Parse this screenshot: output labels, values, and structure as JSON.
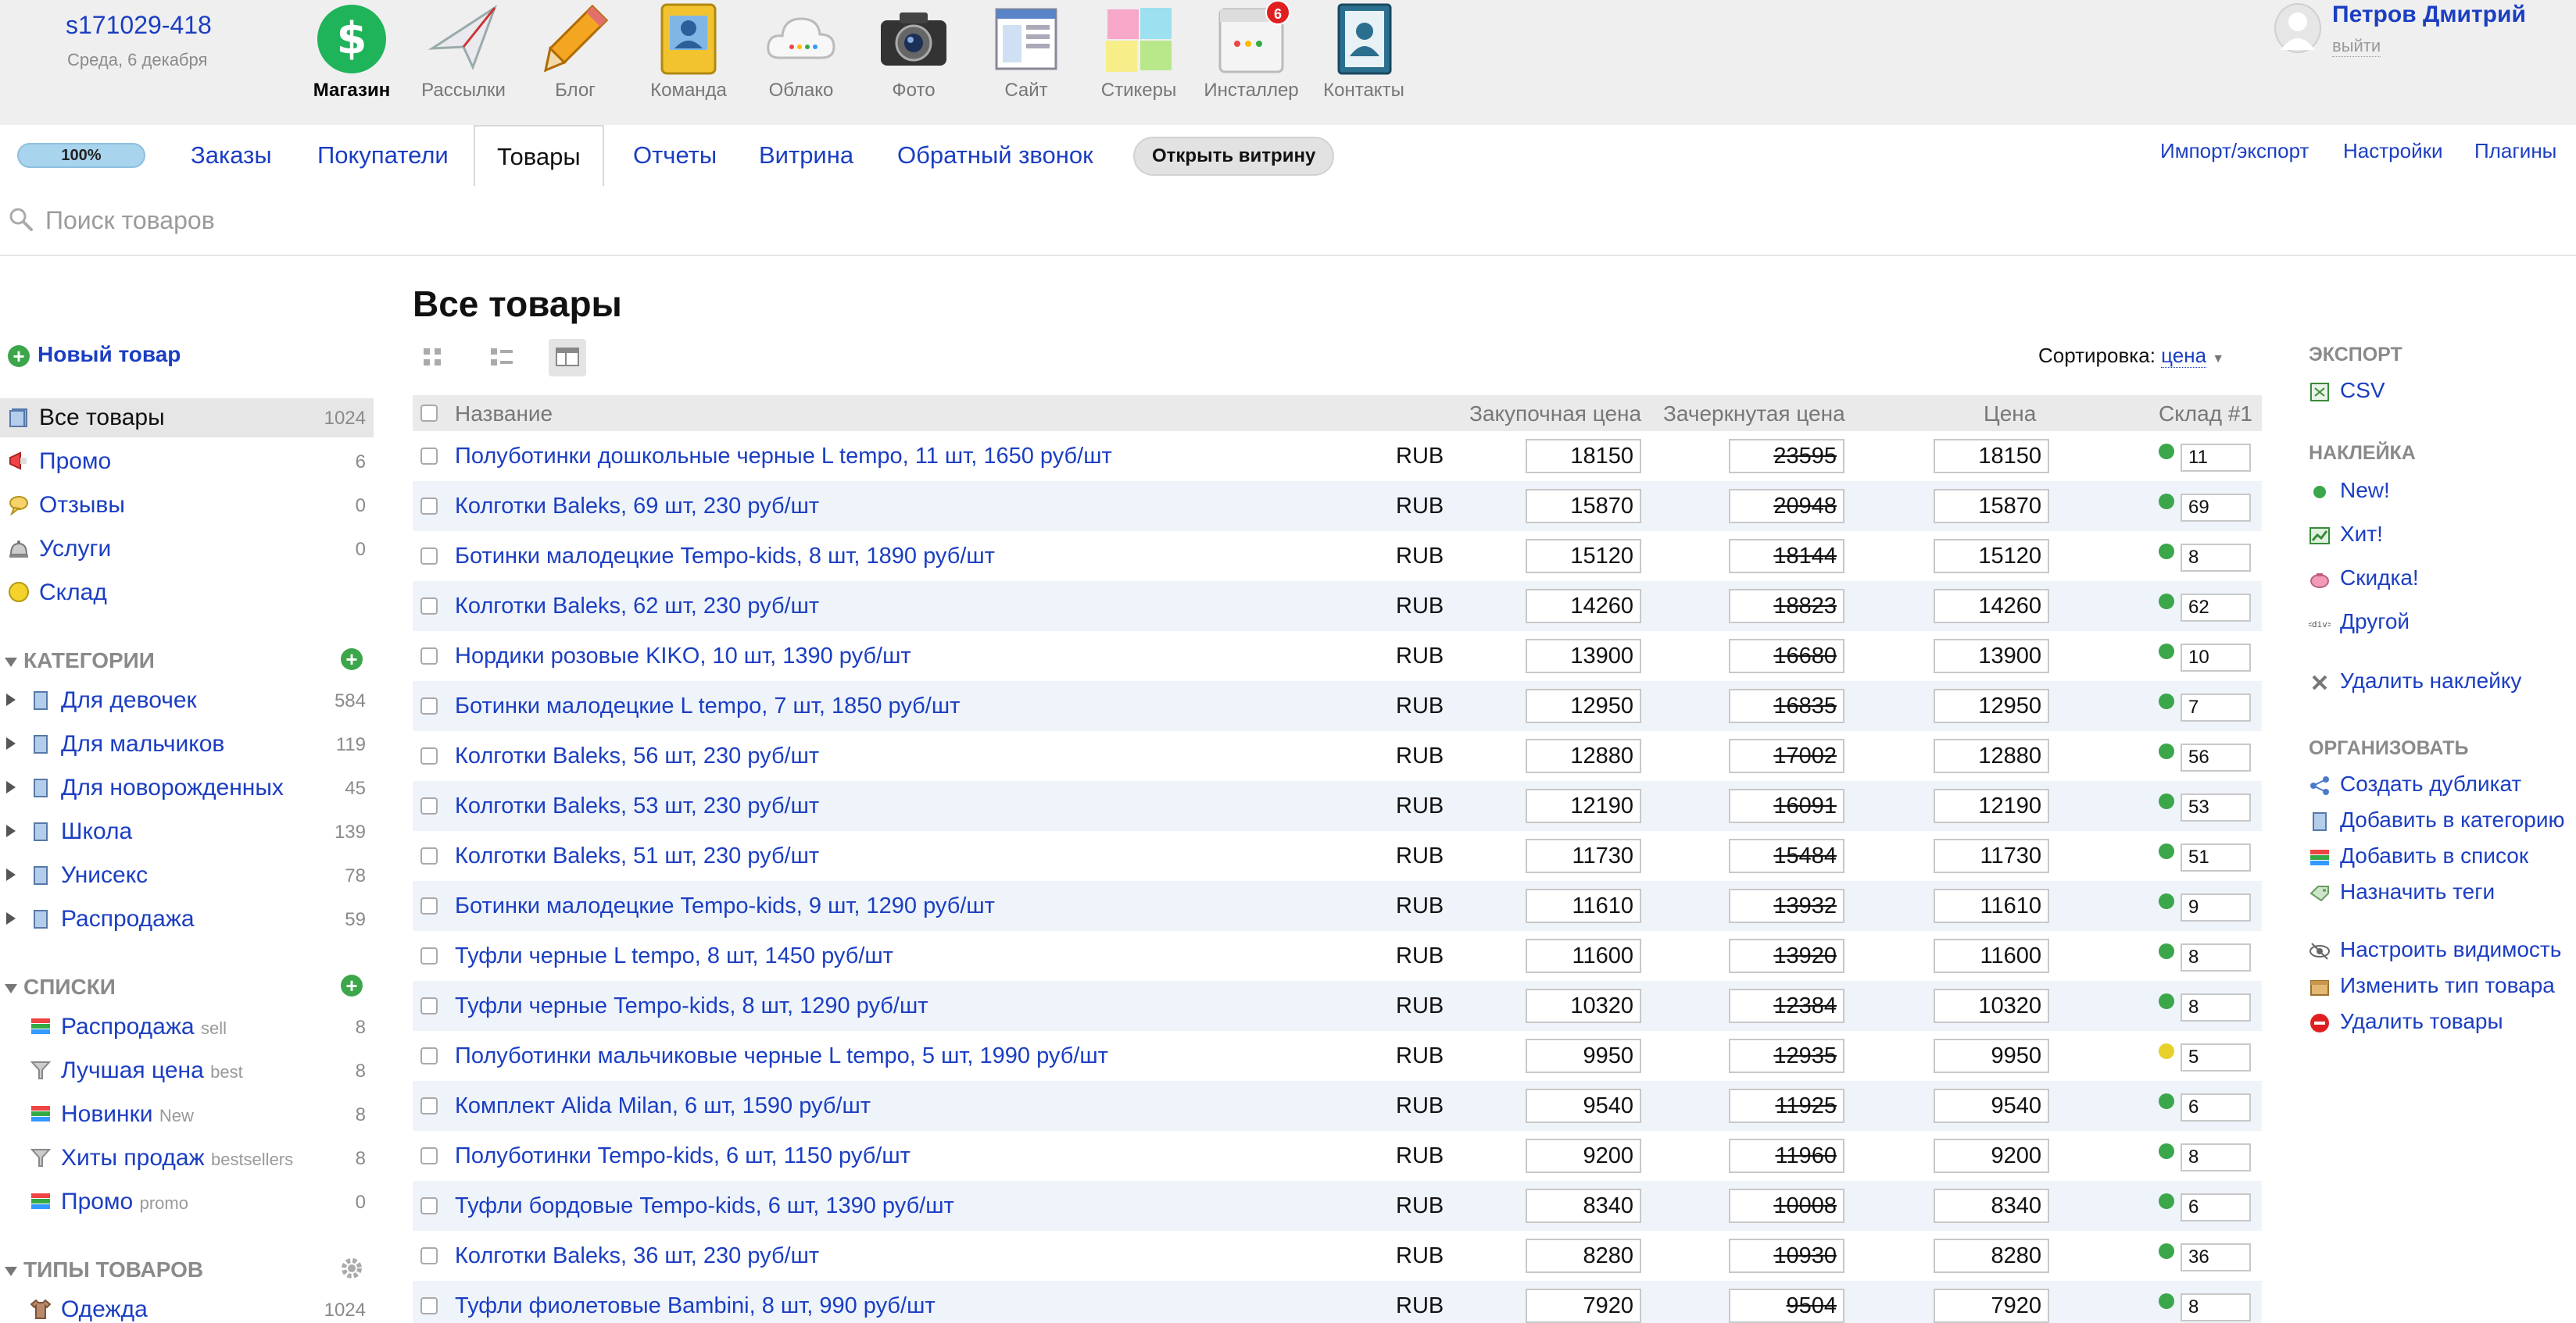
{
  "header": {
    "host": "s171029-418",
    "date": "Среда, 6 декабря",
    "apps": [
      {
        "label": "Магазин",
        "icon": "shop-icon"
      },
      {
        "label": "Рассылки",
        "icon": "mailer-icon"
      },
      {
        "label": "Блог",
        "icon": "blog-icon"
      },
      {
        "label": "Команда",
        "icon": "team-icon"
      },
      {
        "label": "Облако",
        "icon": "cloud-icon"
      },
      {
        "label": "Фото",
        "icon": "photo-icon"
      },
      {
        "label": "Сайт",
        "icon": "site-icon"
      },
      {
        "label": "Стикеры",
        "icon": "stickers-icon"
      },
      {
        "label": "Инсталлер",
        "icon": "installer-icon",
        "badge": "6"
      },
      {
        "label": "Контакты",
        "icon": "contacts-icon"
      }
    ],
    "user": {
      "name": "Петров Дмитрий",
      "logout": "выйти"
    }
  },
  "nav": {
    "progress": "100%",
    "tabs": [
      "Заказы",
      "Покупатели",
      "Товары",
      "Отчеты",
      "Витрина",
      "Обратный звонок"
    ],
    "open_storefront": "Открыть витрину",
    "right_links": [
      "Импорт/экспорт",
      "Настройки",
      "Плагины"
    ]
  },
  "search": {
    "placeholder": "Поиск товаров"
  },
  "sidebar": {
    "new_product": "Новый товар",
    "main": [
      {
        "label": "Все товары",
        "count": "1024"
      },
      {
        "label": "Промо",
        "count": "6"
      },
      {
        "label": "Отзывы",
        "count": "0"
      },
      {
        "label": "Услуги",
        "count": "0"
      },
      {
        "label": "Склад",
        "count": ""
      }
    ],
    "categories_title": "КАТЕГОРИИ",
    "categories": [
      {
        "label": "Для девочек",
        "count": "584"
      },
      {
        "label": "Для мальчиков",
        "count": "119"
      },
      {
        "label": "Для новорожденных",
        "count": "45"
      },
      {
        "label": "Школа",
        "count": "139"
      },
      {
        "label": "Унисекс",
        "count": "78"
      },
      {
        "label": "Распродажа",
        "count": "59"
      }
    ],
    "lists_title": "СПИСКИ",
    "lists": [
      {
        "label": "Распродажа",
        "sub": "sell",
        "count": "8"
      },
      {
        "label": "Лучшая цена",
        "sub": "best",
        "count": "8"
      },
      {
        "label": "Новинки",
        "sub": "New",
        "count": "8"
      },
      {
        "label": "Хиты продаж",
        "sub": "bestsellers",
        "count": "8"
      },
      {
        "label": "Промо",
        "sub": "promo",
        "count": "0"
      }
    ],
    "types_title": "ТИПЫ ТОВАРОВ",
    "types": [
      {
        "label": "Одежда",
        "count": "1024"
      }
    ]
  },
  "main": {
    "title": "Все товары",
    "sort_label": "Сортировка:",
    "sort_value": "цена",
    "columns": {
      "name": "Название",
      "purchase": "Закупочная цена",
      "compare": "Зачеркнутая цена",
      "price": "Цена",
      "stock": "Склад #1"
    },
    "products": [
      {
        "name": "Полуботинки дошкольные черные L tempo, 11 шт, 1650 руб/шт",
        "currency": "RUB",
        "purchase": "18150",
        "compare": "23595",
        "price": "18150",
        "stock": "11",
        "status": "green"
      },
      {
        "name": "Колготки Baleks, 69 шт, 230 руб/шт",
        "currency": "RUB",
        "purchase": "15870",
        "compare": "20948",
        "price": "15870",
        "stock": "69",
        "status": "green"
      },
      {
        "name": "Ботинки малодецкие Tempo-kids, 8 шт, 1890 руб/шт",
        "currency": "RUB",
        "purchase": "15120",
        "compare": "18144",
        "price": "15120",
        "stock": "8",
        "status": "green"
      },
      {
        "name": "Колготки Baleks, 62 шт, 230 руб/шт",
        "currency": "RUB",
        "purchase": "14260",
        "compare": "18823",
        "price": "14260",
        "stock": "62",
        "status": "green"
      },
      {
        "name": "Нордики розовые KIKO, 10 шт, 1390 руб/шт",
        "currency": "RUB",
        "purchase": "13900",
        "compare": "16680",
        "price": "13900",
        "stock": "10",
        "status": "green"
      },
      {
        "name": "Ботинки малодецкие L tempo, 7 шт, 1850 руб/шт",
        "currency": "RUB",
        "purchase": "12950",
        "compare": "16835",
        "price": "12950",
        "stock": "7",
        "status": "green"
      },
      {
        "name": "Колготки Baleks, 56 шт, 230 руб/шт",
        "currency": "RUB",
        "purchase": "12880",
        "compare": "17002",
        "price": "12880",
        "stock": "56",
        "status": "green"
      },
      {
        "name": "Колготки Baleks, 53 шт, 230 руб/шт",
        "currency": "RUB",
        "purchase": "12190",
        "compare": "16091",
        "price": "12190",
        "stock": "53",
        "status": "green"
      },
      {
        "name": "Колготки Baleks, 51 шт, 230 руб/шт",
        "currency": "RUB",
        "purchase": "11730",
        "compare": "15484",
        "price": "11730",
        "stock": "51",
        "status": "green"
      },
      {
        "name": "Ботинки малодецкие Tempo-kids, 9 шт, 1290 руб/шт",
        "currency": "RUB",
        "purchase": "11610",
        "compare": "13932",
        "price": "11610",
        "stock": "9",
        "status": "green"
      },
      {
        "name": "Туфли черные L tempo, 8 шт, 1450 руб/шт",
        "currency": "RUB",
        "purchase": "11600",
        "compare": "13920",
        "price": "11600",
        "stock": "8",
        "status": "green"
      },
      {
        "name": "Туфли черные Tempo-kids, 8 шт, 1290 руб/шт",
        "currency": "RUB",
        "purchase": "10320",
        "compare": "12384",
        "price": "10320",
        "stock": "8",
        "status": "green"
      },
      {
        "name": "Полуботинки мальчиковые черные L tempo, 5 шт, 1990 руб/шт",
        "currency": "RUB",
        "purchase": "9950",
        "compare": "12935",
        "price": "9950",
        "stock": "5",
        "status": "yellow"
      },
      {
        "name": "Комплект Alida Milan, 6 шт, 1590 руб/шт",
        "currency": "RUB",
        "purchase": "9540",
        "compare": "11925",
        "price": "9540",
        "stock": "6",
        "status": "green"
      },
      {
        "name": "Полуботинки Tempo-kids, 6 шт, 1150 руб/шт",
        "currency": "RUB",
        "purchase": "9200",
        "compare": "11960",
        "price": "9200",
        "stock": "8",
        "status": "green"
      },
      {
        "name": "Туфли бордовые Tempo-kids, 6 шт, 1390 руб/шт",
        "currency": "RUB",
        "purchase": "8340",
        "compare": "10008",
        "price": "8340",
        "stock": "6",
        "status": "green"
      },
      {
        "name": "Колготки Baleks, 36 шт, 230 руб/шт",
        "currency": "RUB",
        "purchase": "8280",
        "compare": "10930",
        "price": "8280",
        "stock": "36",
        "status": "green"
      },
      {
        "name": "Туфли фиолетовые Bambini, 8 шт, 990 руб/шт",
        "currency": "RUB",
        "purchase": "7920",
        "compare": "9504",
        "price": "7920",
        "stock": "8",
        "status": "green"
      }
    ]
  },
  "actions": {
    "export_title": "ЭКСПОРТ",
    "export": [
      {
        "label": "CSV",
        "icon": "csv-icon"
      }
    ],
    "badge_title": "НАКЛЕЙКА",
    "badges": [
      {
        "label": "New!",
        "icon": "new-dot-icon"
      },
      {
        "label": "Хит!",
        "icon": "chart-icon"
      },
      {
        "label": "Скидка!",
        "icon": "piggy-icon"
      },
      {
        "label": "Другой",
        "icon": "code-icon"
      }
    ],
    "remove_badge": "Удалить наклейку",
    "organize_title": "ОРГАНИЗОВАТЬ",
    "organize": [
      {
        "label": "Создать дубликат",
        "icon": "share-icon"
      },
      {
        "label": "Добавить в категорию",
        "icon": "folder-icon"
      },
      {
        "label": "Добавить в список",
        "icon": "list-icon"
      },
      {
        "label": "Назначить теги",
        "icon": "tags-icon"
      }
    ],
    "manage": [
      {
        "label": "Настроить видимость",
        "icon": "eye-icon"
      },
      {
        "label": "Изменить тип товара",
        "icon": "box-icon"
      },
      {
        "label": "Удалить товары",
        "icon": "delete-icon"
      }
    ]
  },
  "colors": {
    "link": "#1b3ec2",
    "green": "#3ca64a",
    "yellow": "#e8d02a",
    "badge": "#e02020"
  }
}
